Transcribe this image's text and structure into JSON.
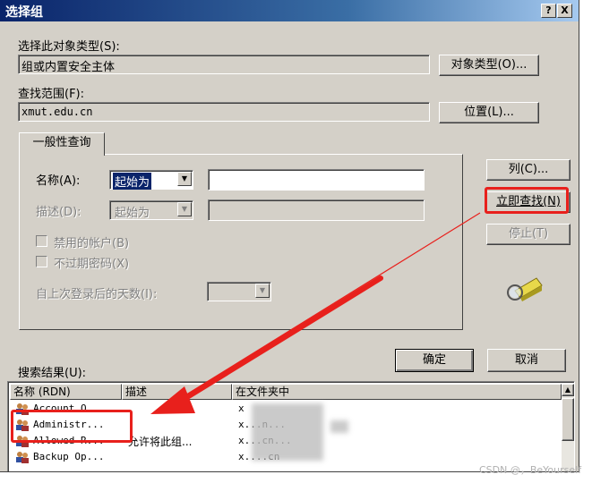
{
  "window": {
    "title": "选择组",
    "help_button": "?",
    "close_button": "X"
  },
  "object_type": {
    "label": "选择此对象类型(S):",
    "value": "组或内置安全主体",
    "button": "对象类型(O)..."
  },
  "scope": {
    "label": "查找范围(F):",
    "value": "xmut.edu.cn",
    "button": "位置(L)..."
  },
  "query_tab": {
    "label": "一般性查询"
  },
  "name_row": {
    "label": "名称(A):",
    "operator": "起始为",
    "value": ""
  },
  "desc_row": {
    "label": "描述(D):",
    "operator": "起始为",
    "value": ""
  },
  "checkboxes": [
    {
      "label": "禁用的帐户(B)",
      "checked": false
    },
    {
      "label": "不过期密码(X)",
      "checked": false
    }
  ],
  "last_logon": {
    "label": "自上次登录后的天数(I):",
    "value": ""
  },
  "side_buttons": {
    "columns": "列(C)...",
    "find_now": "立即查找(N)",
    "stop": "停止(T)"
  },
  "ok_button": "确定",
  "cancel_button": "取消",
  "results": {
    "label": "搜索结果(U):",
    "columns": [
      "名称 (RDN)",
      "描述",
      "在文件夹中"
    ],
    "rows": [
      {
        "name": "Account O...",
        "desc": "",
        "folder": "x"
      },
      {
        "name": "Administr...",
        "desc": "",
        "folder": "x...n..."
      },
      {
        "name": "Allowed R...",
        "desc": "允许将此组...",
        "folder": "x...cn..."
      },
      {
        "name": "Backup Op...",
        "desc": "",
        "folder": "x....cn"
      }
    ]
  },
  "watermark": "CSDN @，BeYourself",
  "colors": {
    "highlight": "#e8201c",
    "title_bar": "#0a246a",
    "dialog_bg": "#d4d0c8"
  }
}
